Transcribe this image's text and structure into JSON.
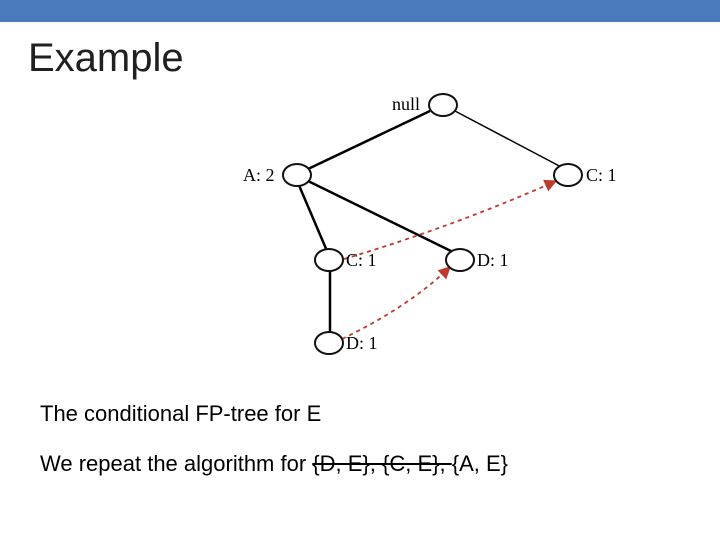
{
  "header": {
    "title": "Example"
  },
  "fp_tree": {
    "nodes": {
      "root": {
        "label": "null"
      },
      "a2": {
        "label": "A: 2"
      },
      "c1r": {
        "label": "C: 1"
      },
      "c1l": {
        "label": "C: 1"
      },
      "d1r": {
        "label": "D: 1"
      },
      "d1b": {
        "label": "D: 1"
      }
    }
  },
  "captions": {
    "line1": "The conditional FP-tree for E",
    "line2_prefix": "We repeat the algorithm for ",
    "line2_strike1": "{D, E}, ",
    "line2_strike2": "{C, E}, ",
    "line2_tail": "{A, E}"
  }
}
